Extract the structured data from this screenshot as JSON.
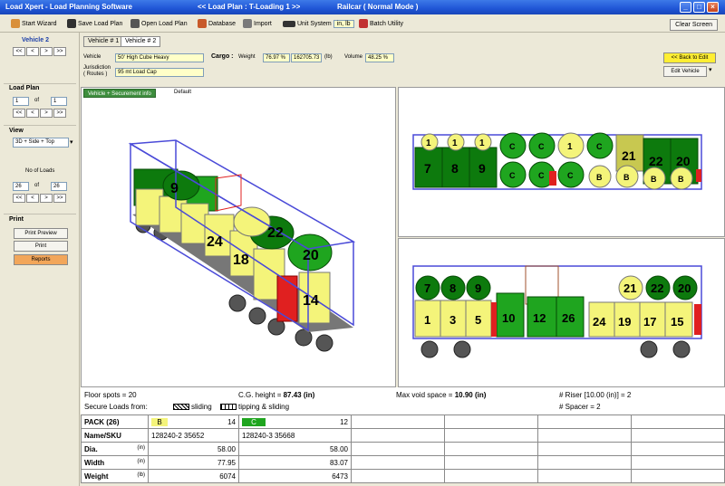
{
  "titlebar": {
    "app": "Load Xpert - Load Planning Software",
    "load_plan": "<< Load Plan : T-Loading 1 >>",
    "mode": "Railcar   ( Normal Mode )"
  },
  "toolbar": {
    "start_wizard": "Start Wizard",
    "save": "Save Load Plan",
    "open": "Open Load Plan",
    "database": "Database",
    "import": "Import",
    "unit_system": "Unit System",
    "unit_value": "in, lb",
    "batch": "Batch Utility",
    "clear": "Clear Screen"
  },
  "left": {
    "vehicle_title": "Vehicle 2",
    "nav": [
      "<<",
      "<",
      ">",
      ">>"
    ],
    "load_plan_title": "Load Plan",
    "lp_current": "1",
    "lp_of": "of",
    "lp_total": "1",
    "view_title": "View",
    "view_value": "3D + Side + Top",
    "num_loads_label": "No of Loads",
    "nl_current": "26",
    "nl_of": "of",
    "nl_total": "26",
    "print_title": "Print",
    "print_preview": "Print Preview",
    "print": "Print",
    "reports": "Reports"
  },
  "vehicle_tabs": [
    "Vehicle # 1",
    "Vehicle # 2"
  ],
  "vehicle_info": {
    "vehicle_label": "Vehicle",
    "vehicle_value": "50' High Cube Heavy",
    "jurisdiction_label": "Jurisdiction\n( Routes )",
    "jurisdiction_value": "95 mt Load Cap",
    "cargo_label": "Cargo :",
    "weight_label": "Weight",
    "weight_pct": "76.97 %",
    "weight_val": "162705.73",
    "weight_unit": "(lb)",
    "volume_label": "Volume",
    "volume_pct": "48.25 %",
    "back_edit": "<< Back to Edit",
    "edit_vehicle": "Edit Vehicle"
  },
  "securement": {
    "button": "Vehicle + Securement info",
    "default": "Default"
  },
  "stats": {
    "floor_spots": "Floor spots = 20",
    "cg_label": "C.G. height = ",
    "cg_value": "87.43 (in)",
    "max_void_label": "Max void space = ",
    "max_void_value": "10.90 (in)",
    "riser": "# Riser [10.00 (in)] = 2",
    "secure_label": "Secure Loads from:",
    "sliding": "sliding",
    "tipping": "tipping & sliding",
    "spacer": "# Spacer = 2"
  },
  "grid": {
    "pack_label": "PACK (26)",
    "pack1_code": "B",
    "pack1_count": "14",
    "pack2_code": "C",
    "pack2_count": "12",
    "name_label": "Name/SKU",
    "name1": "128240-2 35652",
    "name2": "128240-3 35668",
    "dia_label": "Dia.",
    "width_label": "Width",
    "weight_label": "Weight",
    "unit_in": "(in)",
    "unit_lb": "(lb)",
    "dia1": "58.00",
    "dia2": "58.00",
    "width1": "77.95",
    "width2": "83.07",
    "weight1": "6074",
    "weight2": "6473"
  },
  "top_view_labels": [
    "7",
    "8",
    "9",
    "1",
    "1",
    "1",
    "C",
    "C",
    "C",
    "1",
    "C",
    "21",
    "22",
    "20",
    "C",
    "C",
    "B",
    "B",
    "B",
    "B"
  ],
  "side_view_labels": [
    "7",
    "8",
    "9",
    "21",
    "22",
    "20",
    "1",
    "3",
    "5",
    "10",
    "12",
    "26",
    "24",
    "19",
    "17",
    "15"
  ],
  "view3d_labels": [
    "9",
    "22",
    "20",
    "14",
    "24",
    "18"
  ],
  "colors": {
    "yellow": "#f4f47a",
    "green": "#1fa51f",
    "dark_green": "#0d7a0d",
    "red": "#e02020",
    "frame": "#4a4ad8"
  }
}
